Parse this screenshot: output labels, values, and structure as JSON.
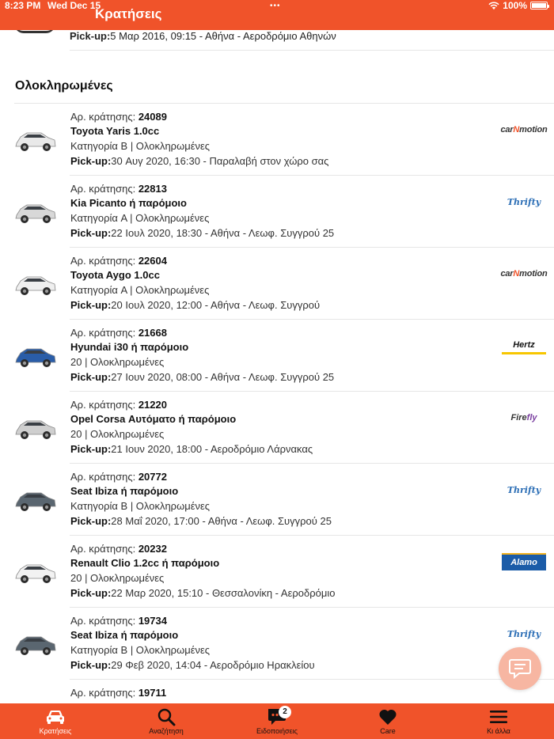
{
  "status_bar": {
    "time": "8:23 PM",
    "date": "Wed Dec 15",
    "battery": "100%"
  },
  "nav": {
    "title": "Κρατήσεις"
  },
  "previous_item": {
    "pickup_label": "Pick-up:",
    "pickup_text": "5 Μαρ 2016, 09:15 - Αθήνα - Αεροδρόμιο Αθηνών"
  },
  "section": {
    "title": "Ολοκληρωμένες"
  },
  "booking_label": "Αρ. κράτησης: ",
  "pickup_label": "Pick-up:",
  "bookings": [
    {
      "number": "24089",
      "car": "Toyota Yaris 1.0cc",
      "meta": "Κατηγορία B | Ολοκληρωμένες",
      "pickup": "30 Αυγ 2020, 16:30 - Παραλαβή στον χώρο σας",
      "logo": "carmotion",
      "car_color": "#e9e9e9"
    },
    {
      "number": "22813",
      "car": "Kia Picanto ή παρόμοιο",
      "meta": "Κατηγορία A | Ολοκληρωμένες",
      "pickup": "22 Ιουλ 2020, 18:30 - Αθήνα - Λεωφ. Συγγρού 25",
      "logo": "thrifty",
      "car_color": "#d8d8d8"
    },
    {
      "number": "22604",
      "car": "Toyota Aygo 1.0cc",
      "meta": "Κατηγορία A | Ολοκληρωμένες",
      "pickup": "20 Ιουλ 2020, 12:00 - Αθήνα - Λεωφ. Συγγρού",
      "logo": "carmotion",
      "car_color": "#efefef"
    },
    {
      "number": "21668",
      "car": "Hyundai i30 ή παρόμοιο",
      "meta": "20 | Ολοκληρωμένες",
      "pickup": "27 Ιουν 2020, 08:00 - Αθήνα - Λεωφ. Συγγρού 25",
      "logo": "hertz",
      "car_color": "#2a5da8"
    },
    {
      "number": "21220",
      "car": "Opel Corsa Αυτόματο ή παρόμοιο",
      "meta": "20 | Ολοκληρωμένες",
      "pickup": "21 Ιουν 2020, 18:00 - Αεροδρόμιο Λάρνακας",
      "logo": "firefly",
      "car_color": "#cfcfcf"
    },
    {
      "number": "20772",
      "car": "Seat Ibiza ή παρόμοιο",
      "meta": "Κατηγορία B | Ολοκληρωμένες",
      "pickup": "28 Μαΐ 2020, 17:00 - Αθήνα - Λεωφ. Συγγρού 25",
      "logo": "thrifty",
      "car_color": "#5a6670"
    },
    {
      "number": "20232",
      "car": "Renault Clio 1.2cc ή παρόμοιο",
      "meta": "20 | Ολοκληρωμένες",
      "pickup": "22 Μαρ 2020, 15:10 - Θεσσαλονίκη - Αεροδρόμιο",
      "logo": "alamo",
      "car_color": "#f2f2f2"
    },
    {
      "number": "19734",
      "car": "Seat Ibiza ή παρόμοιο",
      "meta": "Κατηγορία B | Ολοκληρωμένες",
      "pickup": "29 Φεβ 2020, 14:04 - Αεροδρόμιο Ηρακλείου",
      "logo": "thrifty",
      "car_color": "#5a6670"
    },
    {
      "number": "19711",
      "car": "",
      "meta": "",
      "pickup": "",
      "logo": "alamo",
      "car_color": "#ffffff"
    }
  ],
  "logos": {
    "carmotion": {
      "pre": "car",
      "n": "N",
      "post": "motion"
    },
    "thrifty": {
      "text": "Thrifty"
    },
    "hertz": {
      "text": "Hertz"
    },
    "firefly": {
      "pre": "Fire",
      "post": "fly"
    },
    "alamo": {
      "text": "Alamo"
    }
  },
  "tabs": [
    {
      "label": "Κρατήσεις",
      "icon": "car-icon",
      "active": true
    },
    {
      "label": "Αναζήτηση",
      "icon": "search-icon",
      "active": false
    },
    {
      "label": "Ειδοποιήσεις",
      "icon": "chat-icon",
      "active": false,
      "badge": "2"
    },
    {
      "label": "Care",
      "icon": "heart-icon",
      "active": false
    },
    {
      "label": "Κι άλλα",
      "icon": "menu-icon",
      "active": false
    }
  ],
  "colors": {
    "accent": "#f0532a",
    "fab": "#f7b6a2"
  }
}
